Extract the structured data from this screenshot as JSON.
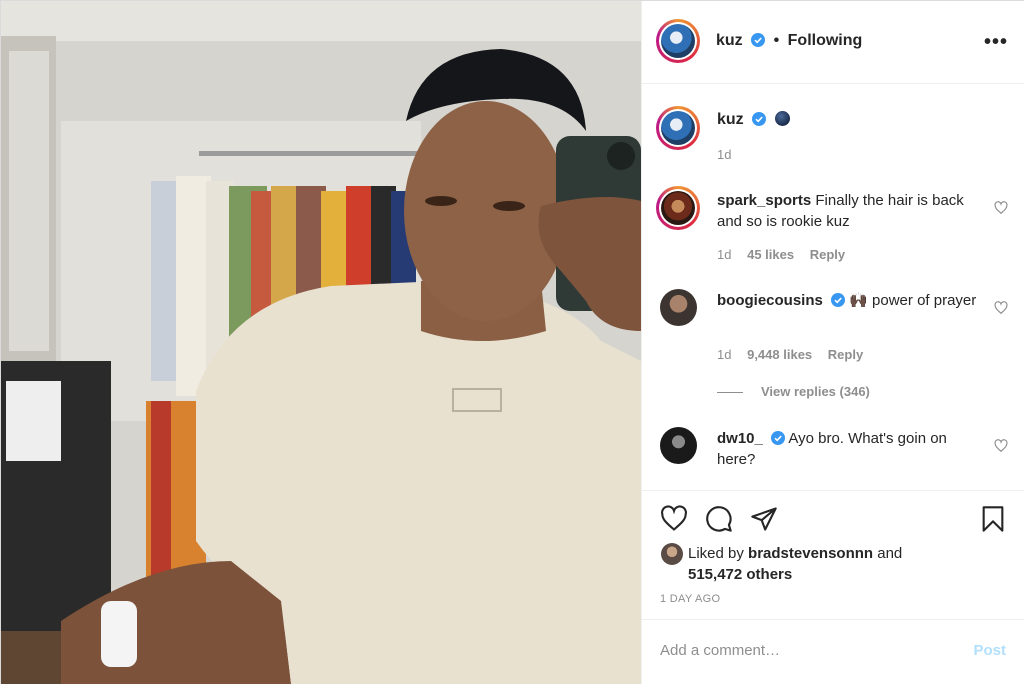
{
  "header": {
    "username": "kuz",
    "separator": "•",
    "follow_status": "Following",
    "more_label": "•••"
  },
  "caption": {
    "username": "kuz",
    "time": "1d"
  },
  "comments": [
    {
      "username": "spark_sports",
      "text": "Finally the hair is back and so is rookie kuz",
      "time": "1d",
      "likes": "45 likes",
      "reply_label": "Reply"
    },
    {
      "username": "boogiecousins",
      "emoji": "🙌🏿",
      "text": " power of prayer",
      "time": "1d",
      "likes": "9,448 likes",
      "reply_label": "Reply",
      "view_replies": "View replies (346)"
    },
    {
      "username": "dw10_",
      "text": "Ayo bro. What's goin on here?"
    }
  ],
  "likes": {
    "prefix": "Liked by ",
    "user": "bradstevensonnn",
    "and": " and",
    "others": "515,472 others"
  },
  "timestamp": "1 DAY AGO",
  "add_comment": {
    "placeholder": "Add a comment…",
    "post_label": "Post"
  },
  "icons": {
    "like": "heart-icon",
    "comment": "comment-icon",
    "share": "share-icon",
    "save": "bookmark-icon",
    "verified": "verified-badge-icon"
  },
  "colors": {
    "verified": "#3897f0",
    "post_disabled": "#b2dffc",
    "muted": "#8e8e8e"
  }
}
